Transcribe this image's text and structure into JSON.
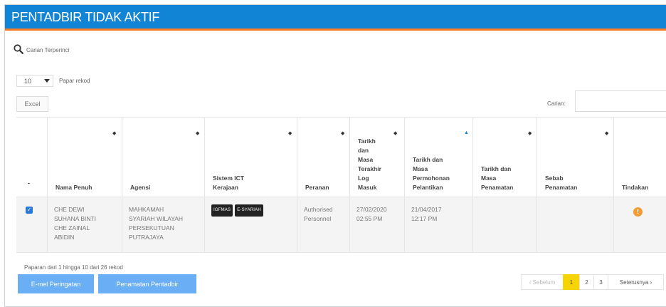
{
  "header": {
    "title": "PENTADBIR TIDAK AKTIF"
  },
  "advanced_search": {
    "label": "Carian Terperinci",
    "icon": "search-icon"
  },
  "length": {
    "value": "10",
    "label": "Papar rekod"
  },
  "toolbar": {
    "excel_label": "Excel",
    "search_label": "Carian:",
    "search_value": ""
  },
  "table": {
    "columns": [
      "-",
      "Nama Penuh",
      "Agensi",
      "Sistem ICT\nKerajaan",
      "Peranan",
      "Tarikh\ndan\nMasa\nTerakhir\nLog\nMasuk",
      "Tarikh dan\nMasa\nPermohonan\nPelantikan",
      "Tarikh dan\nMasa\nPenamatan",
      "Sebab\nPenamatan",
      "Tindakan"
    ],
    "rows": [
      {
        "checked": true,
        "nama": "CHE DEWI\nSUHANA BINTI\nCHE ZAINAL\nABIDIN",
        "agensi": "MAHKAMAH\nSYARIAH WILAYAH\nPERSEKUTUAN\nPUTRAJAYA",
        "sistem": [
          "IGFMAS",
          "E-SYARIAH"
        ],
        "peranan": "Authorised\nPersonnel",
        "log_masuk": "27/02/2020\n02:55 PM",
        "permohonan": "21/04/2017\n12:17 PM",
        "penamatan": "",
        "sebab": "",
        "tindakan_icon": "!"
      }
    ]
  },
  "footer": {
    "info": "Paparan dari 1 hingga 10 dari 26 rekod",
    "email_btn": "E-mel Peringatan",
    "terminate_btn": "Penamatan Pentadbir",
    "pagination": {
      "prev": "‹ Sebelum",
      "pages": [
        "1",
        "2",
        "3"
      ],
      "next": "Seterusnya ›",
      "current": "1"
    }
  },
  "colors": {
    "header_bg": "#1284d6",
    "accent_line": "#f47b2a",
    "button": "#6aaef5",
    "active_page": "#f5d400"
  }
}
